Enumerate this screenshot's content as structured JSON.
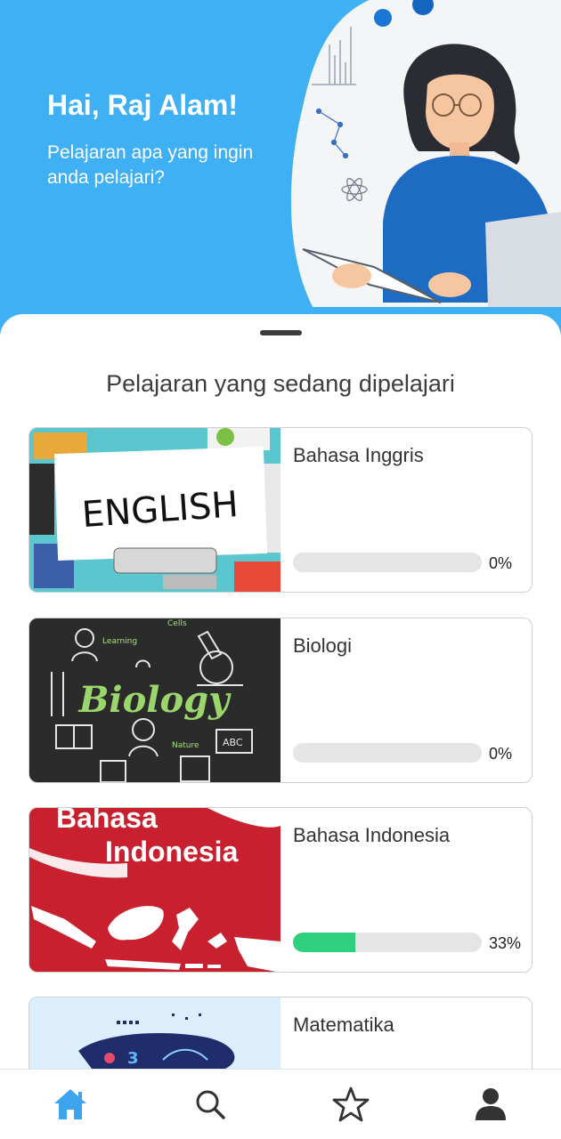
{
  "header": {
    "greeting": "Hai, Raj Alam!",
    "subtitle": "Pelajaran apa yang ingin anda pelajari?"
  },
  "section": {
    "title": "Pelajaran yang sedang dipelajari"
  },
  "courses": [
    {
      "name": "Bahasa Inggris",
      "progress_label": "0%",
      "progress": 0,
      "thumbnail_text": "ENGLISH"
    },
    {
      "name": "Biologi",
      "progress_label": "0%",
      "progress": 0,
      "thumbnail_text": "Biology",
      "thumbnail_labels": [
        "Learning",
        "Nature",
        "ABC",
        "Cells"
      ]
    },
    {
      "name": "Bahasa Indonesia",
      "progress_label": "33%",
      "progress": 0.33,
      "thumbnail_text": [
        "Bahasa",
        "Indonesia"
      ]
    },
    {
      "name": "Matematika",
      "progress_label": "",
      "progress": null,
      "thumbnail_text": "3"
    }
  ],
  "nav": {
    "items": [
      {
        "icon": "home-icon",
        "active": true
      },
      {
        "icon": "search-icon",
        "active": false
      },
      {
        "icon": "star-icon",
        "active": false
      },
      {
        "icon": "profile-icon",
        "active": false
      }
    ]
  },
  "colors": {
    "header_bg": "#3fb0f3",
    "progress_fill": "#2ecf7d",
    "progress_track": "#e5e5e5",
    "nav_active": "#3fa4ee",
    "nav_inactive": "#333333"
  }
}
